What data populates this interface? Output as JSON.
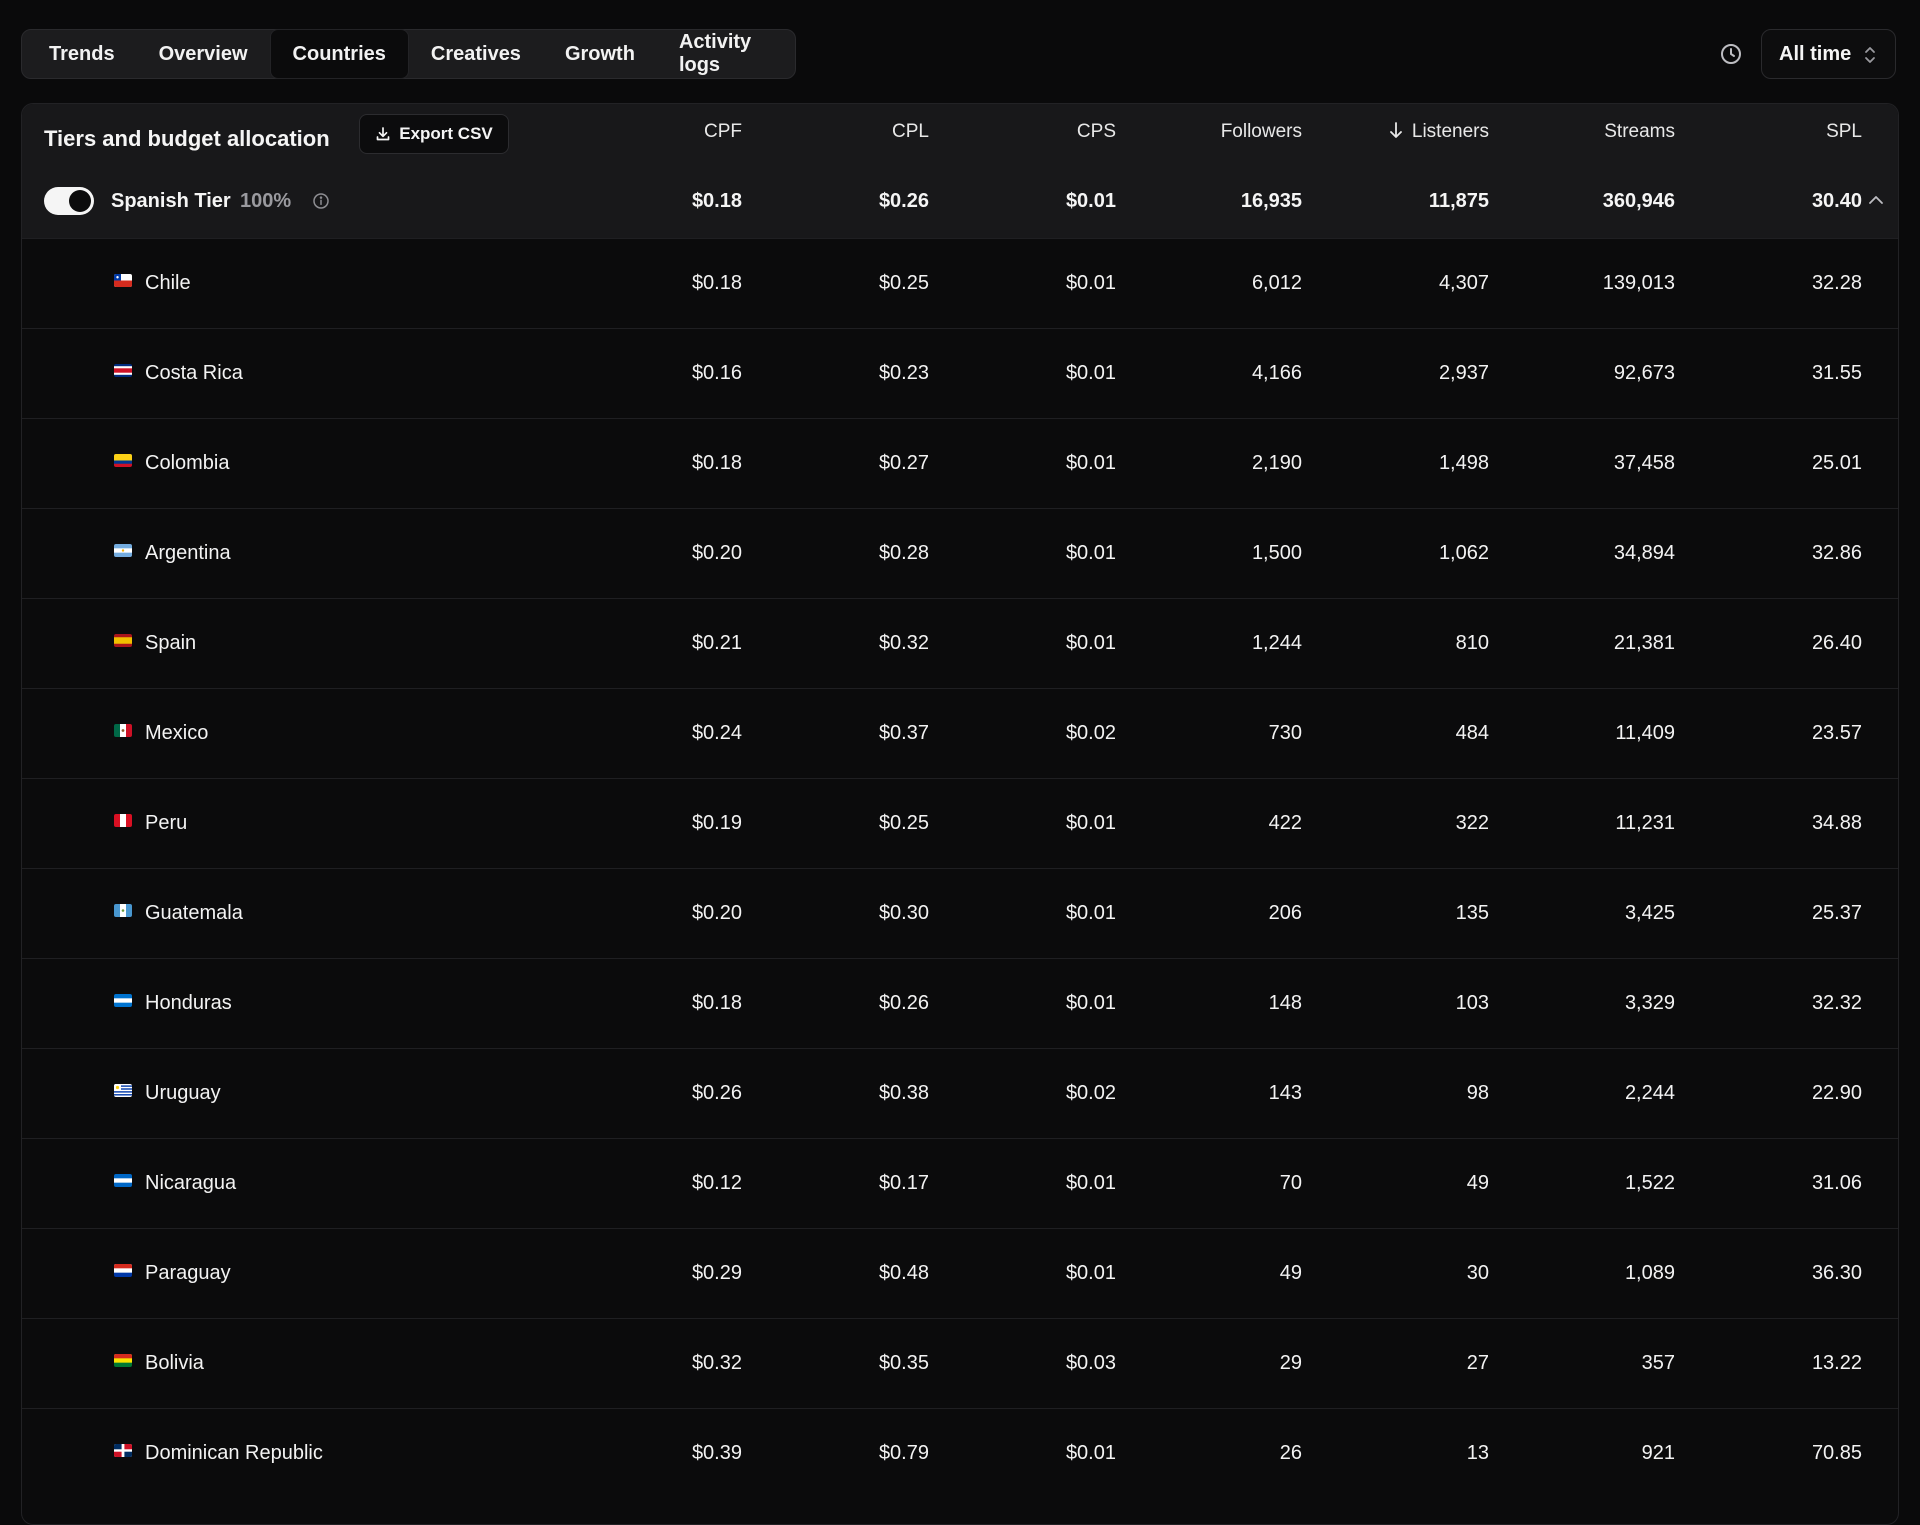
{
  "tabs": [
    "Trends",
    "Overview",
    "Countries",
    "Creatives",
    "Growth",
    "Activity logs"
  ],
  "active_tab": "Countries",
  "range_select": {
    "value": "All time"
  },
  "panel": {
    "title": "Tiers and budget allocation",
    "export_label": "Export CSV",
    "columns": [
      "CPF",
      "CPL",
      "CPS",
      "Followers",
      "Listeners",
      "Streams",
      "SPL"
    ],
    "sorted_column": "Listeners",
    "sort_direction": "descending"
  },
  "tier": {
    "name": "Spanish Tier",
    "percent": "100%",
    "enabled": true,
    "values": [
      "$0.18",
      "$0.26",
      "$0.01",
      "16,935",
      "11,875",
      "360,946",
      "30.40"
    ]
  },
  "rows": [
    {
      "country": "Chile",
      "flag": "chile",
      "values": [
        "$0.18",
        "$0.25",
        "$0.01",
        "6,012",
        "4,307",
        "139,013",
        "32.28"
      ]
    },
    {
      "country": "Costa Rica",
      "flag": "costa-rica",
      "values": [
        "$0.16",
        "$0.23",
        "$0.01",
        "4,166",
        "2,937",
        "92,673",
        "31.55"
      ]
    },
    {
      "country": "Colombia",
      "flag": "colombia",
      "values": [
        "$0.18",
        "$0.27",
        "$0.01",
        "2,190",
        "1,498",
        "37,458",
        "25.01"
      ]
    },
    {
      "country": "Argentina",
      "flag": "argentina",
      "values": [
        "$0.20",
        "$0.28",
        "$0.01",
        "1,500",
        "1,062",
        "34,894",
        "32.86"
      ]
    },
    {
      "country": "Spain",
      "flag": "spain",
      "values": [
        "$0.21",
        "$0.32",
        "$0.01",
        "1,244",
        "810",
        "21,381",
        "26.40"
      ]
    },
    {
      "country": "Mexico",
      "flag": "mexico",
      "values": [
        "$0.24",
        "$0.37",
        "$0.02",
        "730",
        "484",
        "11,409",
        "23.57"
      ]
    },
    {
      "country": "Peru",
      "flag": "peru",
      "values": [
        "$0.19",
        "$0.25",
        "$0.01",
        "422",
        "322",
        "11,231",
        "34.88"
      ]
    },
    {
      "country": "Guatemala",
      "flag": "guatemala",
      "values": [
        "$0.20",
        "$0.30",
        "$0.01",
        "206",
        "135",
        "3,425",
        "25.37"
      ]
    },
    {
      "country": "Honduras",
      "flag": "honduras",
      "values": [
        "$0.18",
        "$0.26",
        "$0.01",
        "148",
        "103",
        "3,329",
        "32.32"
      ]
    },
    {
      "country": "Uruguay",
      "flag": "uruguay",
      "values": [
        "$0.26",
        "$0.38",
        "$0.02",
        "143",
        "98",
        "2,244",
        "22.90"
      ]
    },
    {
      "country": "Nicaragua",
      "flag": "nicaragua",
      "values": [
        "$0.12",
        "$0.17",
        "$0.01",
        "70",
        "49",
        "1,522",
        "31.06"
      ]
    },
    {
      "country": "Paraguay",
      "flag": "paraguay",
      "values": [
        "$0.29",
        "$0.48",
        "$0.01",
        "49",
        "30",
        "1,089",
        "36.30"
      ]
    },
    {
      "country": "Bolivia",
      "flag": "bolivia",
      "values": [
        "$0.32",
        "$0.35",
        "$0.03",
        "29",
        "27",
        "357",
        "13.22"
      ]
    },
    {
      "country": "Dominican Republic",
      "flag": "dominican-republic",
      "values": [
        "$0.39",
        "$0.79",
        "$0.01",
        "26",
        "13",
        "921",
        "70.85"
      ]
    }
  ]
}
